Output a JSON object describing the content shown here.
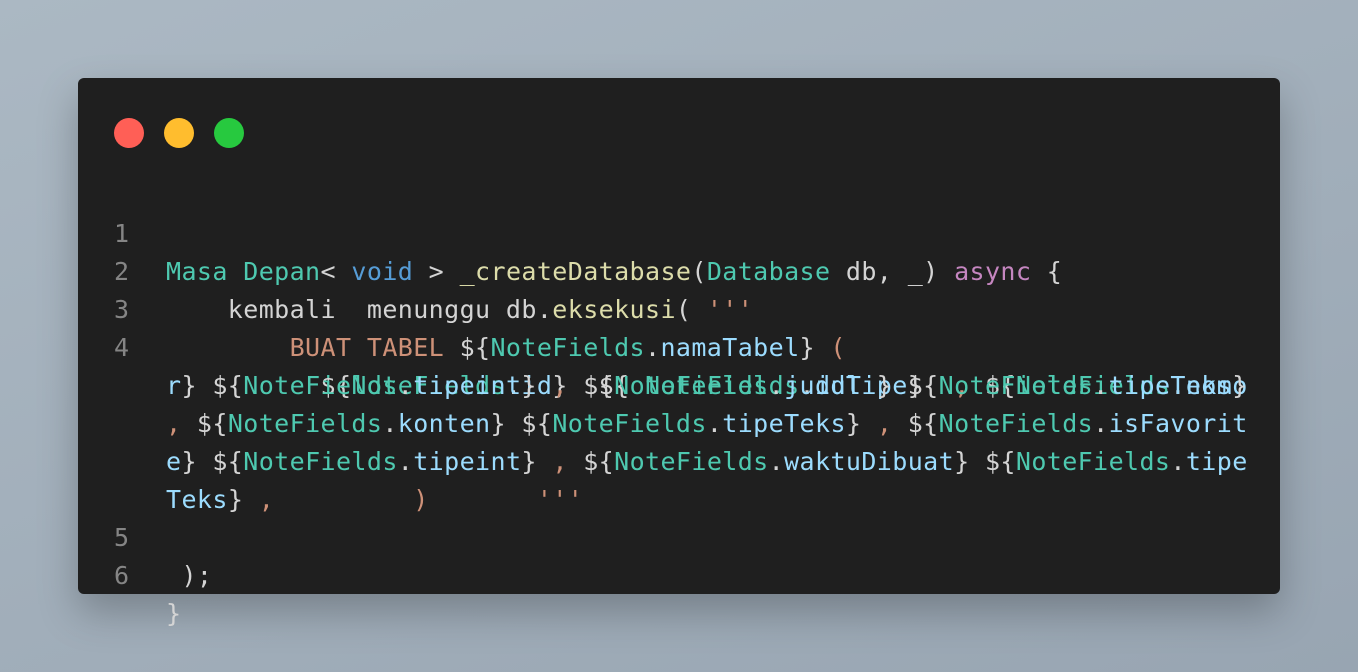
{
  "window": {
    "controls": [
      "close",
      "minimize",
      "maximize"
    ],
    "colors": {
      "close": "#ff5f56",
      "minimize": "#ffbd2e",
      "maximize": "#27c93f",
      "background": "#1f1f1f"
    }
  },
  "code": {
    "line_numbers": [
      "1",
      "2",
      "3",
      "4",
      "5",
      "6"
    ],
    "line1": {
      "t1": "Masa Depan",
      "t2": "< ",
      "t3": "void",
      "t4": " > ",
      "t5": "_createDatabase",
      "t6": "(",
      "t7": "Database",
      "t8": " db, _) ",
      "t9": "async",
      "t10": " {"
    },
    "line2": {
      "t1": "    kembali  menunggu db.",
      "t2": "eksekusi",
      "t3": "( ",
      "t4": "'''"
    },
    "line3": {
      "t1": "        BUAT TABEL ",
      "t2": "${",
      "t3": "NoteFields",
      "t4": ".",
      "t5": "namaTabel",
      "t6": "} ",
      "t7": "("
    },
    "line4a": {
      "t1": "          ${",
      "t2": "NoteFields",
      "t3": ".",
      "t4": "id",
      "t5": "}  ${ ",
      "t6": "NoteFields",
      "t7": ".",
      "t8": "idTipe",
      "t9": "}  ",
      "t10": ",",
      "t11": " ${",
      "t12": "NoteFields",
      "t13": ".",
      "t14": "nomo"
    },
    "line4b": {
      "t1": "r",
      "t2": "} ${",
      "t3": "NoteFields",
      "t4": ".",
      "t5": "tipeint",
      "t6": "} ",
      "t7": ",",
      "t8": " ${",
      "t9": "NoteFields",
      "t10": ".",
      "t11": "judul",
      "t12": " } ${",
      "t13": "NoteFields",
      "t14": ".",
      "t15": "tipeTeks",
      "t16": "}"
    },
    "line4c": {
      "t1": ",",
      "t2": " ${",
      "t3": "NoteFields",
      "t4": ".",
      "t5": "konten",
      "t6": "} ${",
      "t7": "NoteFields",
      "t8": ".",
      "t9": "tipeTeks",
      "t10": "} ",
      "t11": ",",
      "t12": " ${",
      "t13": "NoteFields",
      "t14": ".",
      "t15": "isFavorit"
    },
    "line4d": {
      "t1": "e",
      "t2": "} ${",
      "t3": "NoteFields",
      "t4": ".",
      "t5": "tipeint",
      "t6": "} ",
      "t7": ",",
      "t8": " ${",
      "t9": "NoteFields",
      "t10": ".",
      "t11": "waktuDibuat",
      "t12": "} ${",
      "t13": "NoteFields",
      "t14": ".",
      "t15": "tipe"
    },
    "line4e": {
      "t1": "Teks",
      "t2": "} ",
      "t3": ",         )       '''"
    },
    "line5": {
      "t1": " );"
    },
    "line6": {
      "t1": "}"
    }
  }
}
